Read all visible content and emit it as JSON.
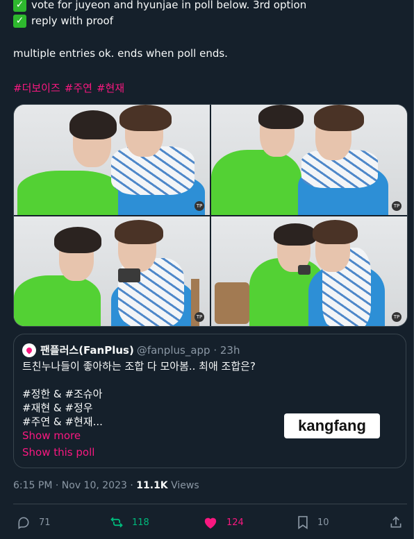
{
  "tweet": {
    "lines": [
      "vote for juyeon and hyunjae in poll below. 3rd option",
      "reply with proof",
      "multiple entries ok. ends when poll ends."
    ],
    "hashtags": [
      "#더보이즈",
      "#주연",
      "#현재"
    ]
  },
  "quoted_tweet": {
    "name": "팬플러스(FanPlus)",
    "handle": "@fanplus_app",
    "time": "23h",
    "text": "트친누나들이 좋아하는 조합 다 모아봄.. 최애 조합은?",
    "tags": [
      "#정한 & #조슈아",
      "#재현 & #정우",
      "#주연 & #현재..."
    ],
    "show_more": "Show more",
    "show_poll": "Show this poll"
  },
  "watermark": "kangfang",
  "meta": {
    "time": "6:15 PM",
    "date": "Nov 10, 2023",
    "views_count": "11.1K",
    "views_label": "Views"
  },
  "actions": {
    "replies": "71",
    "retweets": "118",
    "likes": "124",
    "bookmarks": "10"
  },
  "colors": {
    "background": "#15202b",
    "accent_pink": "#f91880",
    "retweet_green": "#00ba7c",
    "muted": "#8b98a5"
  }
}
